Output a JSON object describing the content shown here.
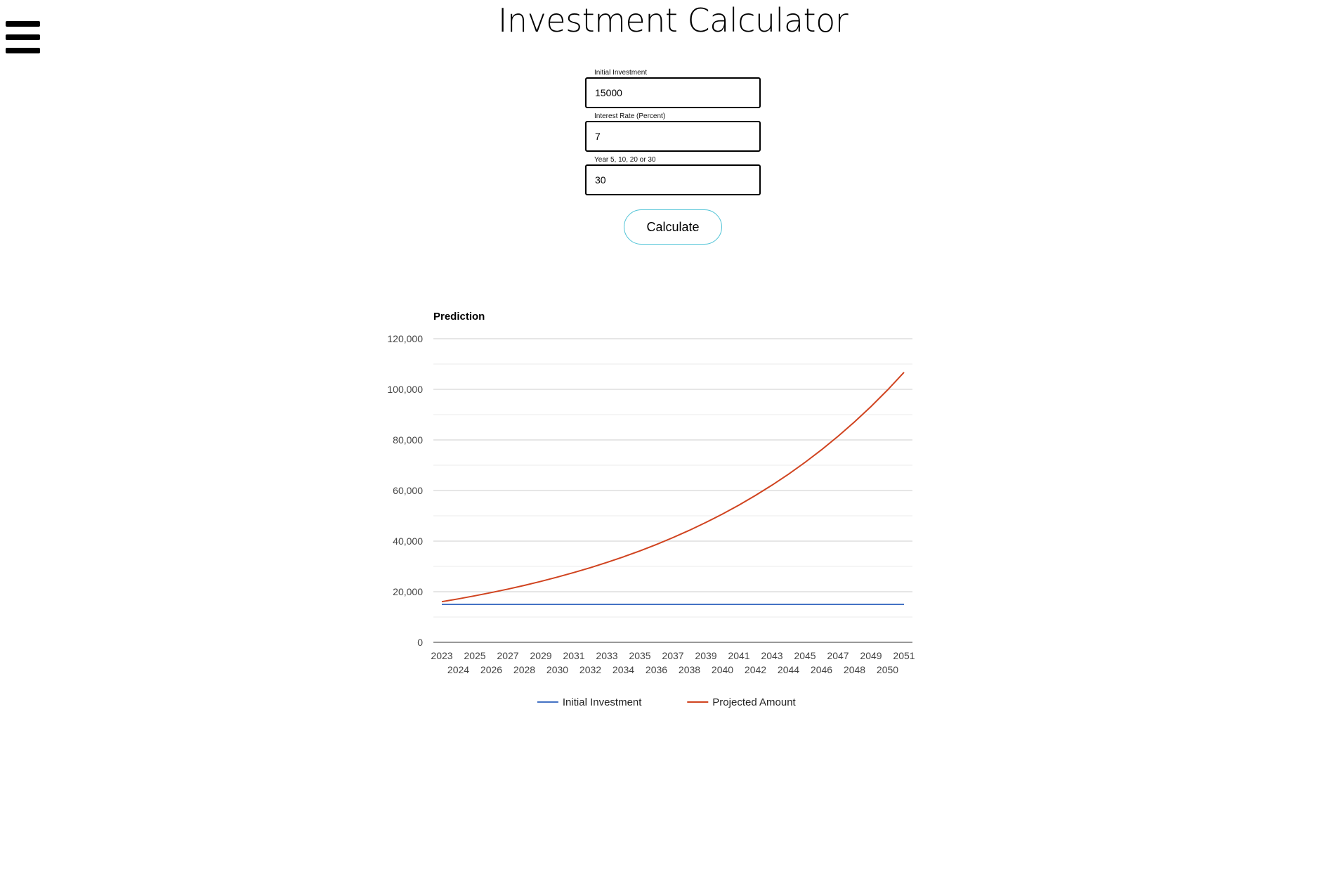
{
  "header": {
    "title": "Investment Calculator",
    "menu_icon": "hamburger-menu-icon"
  },
  "form": {
    "initial_investment": {
      "label": "Initial Investment",
      "value": "15000"
    },
    "interest_rate": {
      "label": "Interest Rate (Percent)",
      "value": "7"
    },
    "years": {
      "label": "Year 5, 10, 20 or 30",
      "value": "30"
    },
    "calculate_label": "Calculate",
    "button_border_color": "#4fc3d6"
  },
  "chart_data": {
    "type": "line",
    "title": "Prediction",
    "xlabel": "",
    "ylabel": "",
    "ylim": [
      0,
      120000
    ],
    "y_ticks": [
      "0",
      "20,000",
      "40,000",
      "60,000",
      "80,000",
      "100,000",
      "120,000"
    ],
    "x": [
      "2023",
      "2024",
      "2025",
      "2026",
      "2027",
      "2028",
      "2029",
      "2030",
      "2031",
      "2032",
      "2033",
      "2034",
      "2035",
      "2036",
      "2037",
      "2038",
      "2039",
      "2040",
      "2041",
      "2042",
      "2043",
      "2044",
      "2045",
      "2046",
      "2047",
      "2048",
      "2049",
      "2050",
      "2051"
    ],
    "series": [
      {
        "name": "Initial Investment",
        "color": "#4472c4",
        "values": [
          15000,
          15000,
          15000,
          15000,
          15000,
          15000,
          15000,
          15000,
          15000,
          15000,
          15000,
          15000,
          15000,
          15000,
          15000,
          15000,
          15000,
          15000,
          15000,
          15000,
          15000,
          15000,
          15000,
          15000,
          15000,
          15000,
          15000,
          15000,
          15000
        ]
      },
      {
        "name": "Projected Amount",
        "color": "#d0431f",
        "values": [
          16050,
          17174,
          18376,
          19662,
          21038,
          22511,
          24087,
          25773,
          27577,
          29507,
          31573,
          33783,
          36148,
          38678,
          41386,
          44283,
          47382,
          50699,
          54248,
          58045,
          62108,
          66456,
          71108,
          76085,
          81411,
          87110,
          93208,
          99732,
          106714
        ]
      }
    ],
    "grid": true,
    "legend_position": "bottom"
  }
}
